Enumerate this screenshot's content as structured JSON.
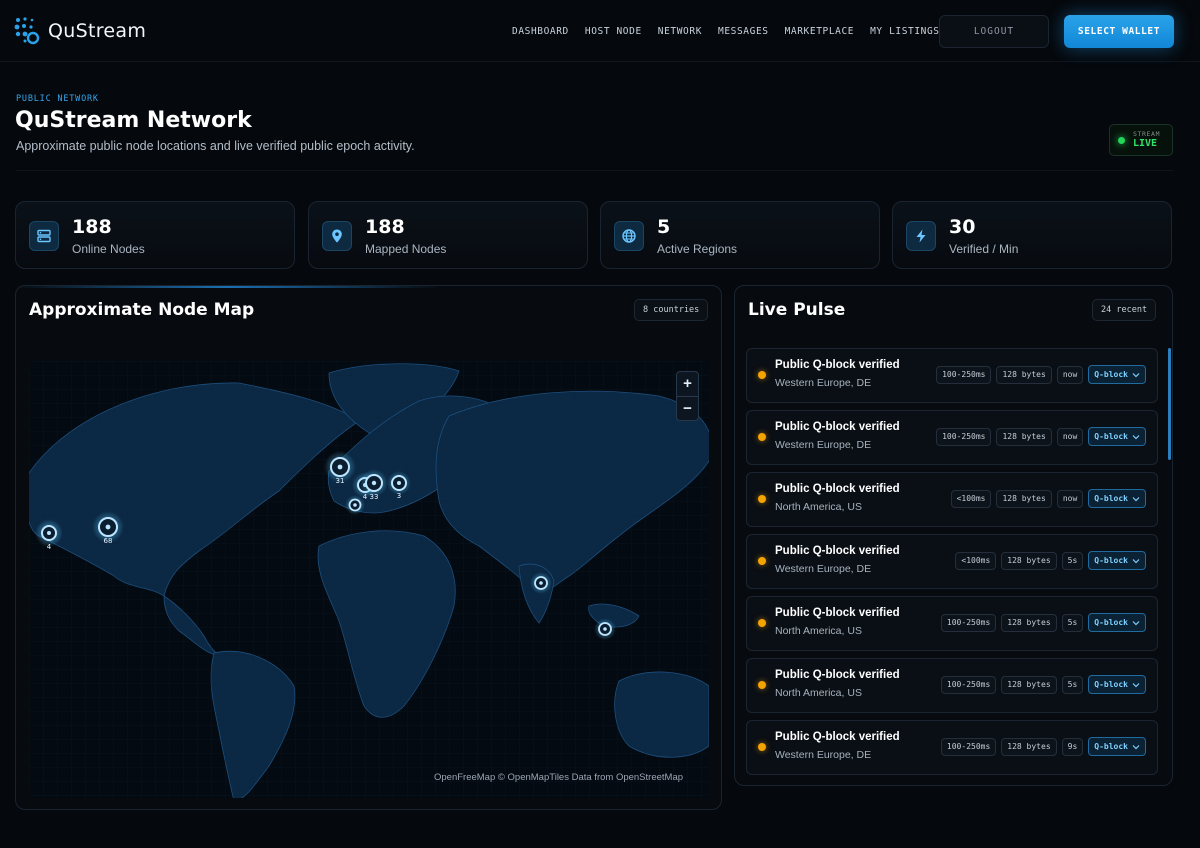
{
  "brand": {
    "name": "QuStream"
  },
  "nav": [
    "DASHBOARD",
    "HOST NODE",
    "NETWORK",
    "MESSAGES",
    "MARKETPLACE",
    "MY LISTINGS"
  ],
  "actions": {
    "logout": "LOGOUT",
    "wallet": "SELECT WALLET"
  },
  "page": {
    "eyebrow": "PUBLIC NETWORK",
    "title": "QuStream Network",
    "subtitle": "Approximate public node locations and live verified public epoch activity."
  },
  "live": {
    "label": "STREAM",
    "status": "LIVE",
    "color": "#22d65a"
  },
  "stats": [
    {
      "value": "188",
      "label": "Online Nodes",
      "icon": "server-icon"
    },
    {
      "value": "188",
      "label": "Mapped Nodes",
      "icon": "map-pin-icon"
    },
    {
      "value": "5",
      "label": "Active Regions",
      "icon": "globe-icon"
    },
    {
      "value": "30",
      "label": "Verified / Min",
      "icon": "bolt-icon"
    }
  ],
  "map": {
    "title": "Approximate Node Map",
    "countries": "8 countries",
    "zoom_in": "+",
    "zoom_out": "−",
    "attribution": "OpenFreeMap © OpenMapTiles Data from OpenStreetMap",
    "markers": [
      "4",
      "68",
      "31",
      "4",
      "33",
      "3",
      "",
      "",
      ""
    ]
  },
  "pulse": {
    "title": "Live Pulse",
    "recent": "24 recent",
    "items": [
      {
        "title": "Public Q-block verified",
        "region": "Western Europe, DE",
        "latency": "100-250ms",
        "size": "128 bytes",
        "age": "now",
        "type": "Q-block"
      },
      {
        "title": "Public Q-block verified",
        "region": "Western Europe, DE",
        "latency": "100-250ms",
        "size": "128 bytes",
        "age": "now",
        "type": "Q-block"
      },
      {
        "title": "Public Q-block verified",
        "region": "North America, US",
        "latency": "<100ms",
        "size": "128 bytes",
        "age": "now",
        "type": "Q-block"
      },
      {
        "title": "Public Q-block verified",
        "region": "Western Europe, DE",
        "latency": "<100ms",
        "size": "128 bytes",
        "age": "5s",
        "type": "Q-block"
      },
      {
        "title": "Public Q-block verified",
        "region": "North America, US",
        "latency": "100-250ms",
        "size": "128 bytes",
        "age": "5s",
        "type": "Q-block"
      },
      {
        "title": "Public Q-block verified",
        "region": "North America, US",
        "latency": "100-250ms",
        "size": "128 bytes",
        "age": "5s",
        "type": "Q-block"
      },
      {
        "title": "Public Q-block verified",
        "region": "Western Europe, DE",
        "latency": "100-250ms",
        "size": "128 bytes",
        "age": "9s",
        "type": "Q-block"
      }
    ]
  },
  "colors": {
    "accent": "#1e9be6",
    "pulse_dot": "#f5a300",
    "node": "#bfe6ff"
  }
}
